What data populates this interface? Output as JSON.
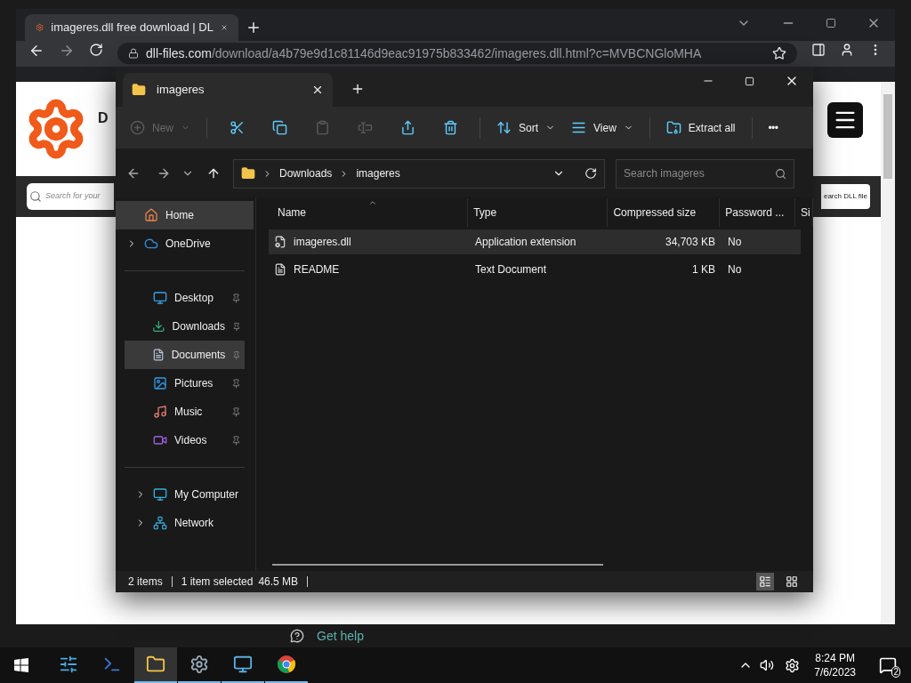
{
  "browser": {
    "tab_title": "imageres.dll free download | DL",
    "url_domain": "dll-files.com",
    "url_path": "/download/a4b79e9d1c81146d9eac91975b833462/imageres.dll.html?c=MVBCNGloMHA",
    "page": {
      "site_title": "D",
      "search_placeholder": "Search for your",
      "search_button": "earch DLL file"
    }
  },
  "explorer": {
    "tab_title": "imageres",
    "toolbar": [
      {
        "kind": "menu",
        "label": "New",
        "disabled": true
      },
      {
        "kind": "separator"
      },
      {
        "kind": "icon",
        "disabled": false
      },
      {
        "kind": "icon",
        "disabled": false
      },
      {
        "kind": "icon",
        "disabled": true
      },
      {
        "kind": "icon",
        "disabled": true
      },
      {
        "kind": "icon",
        "disabled": false
      },
      {
        "kind": "icon",
        "disabled": false
      },
      {
        "kind": "separator"
      },
      {
        "kind": "menu",
        "label": "Sort",
        "disabled": false
      },
      {
        "kind": "menu",
        "label": "View",
        "disabled": false
      },
      {
        "kind": "separator"
      },
      {
        "kind": "button",
        "label": "Extract all",
        "disabled": false
      },
      {
        "kind": "separator"
      },
      {
        "kind": "text",
        "label": "•••",
        "disabled": false
      }
    ],
    "breadcrumb": [
      "Downloads",
      "imageres"
    ],
    "search_placeholder": "Search imageres",
    "sidebar": [
      [
        {
          "label": "Home",
          "expandable": false,
          "pinned": false,
          "highlighted": true
        },
        {
          "label": "OneDrive",
          "expandable": true,
          "pinned": false,
          "highlighted": false
        }
      ],
      [
        {
          "label": "Desktop",
          "expandable": false,
          "pinned": true,
          "highlighted": false
        },
        {
          "label": "Downloads",
          "expandable": false,
          "pinned": true,
          "highlighted": false
        },
        {
          "label": "Documents",
          "expandable": false,
          "pinned": true,
          "highlighted": true
        },
        {
          "label": "Pictures",
          "expandable": false,
          "pinned": true,
          "highlighted": false
        },
        {
          "label": "Music",
          "expandable": false,
          "pinned": true,
          "highlighted": false
        },
        {
          "label": "Videos",
          "expandable": false,
          "pinned": true,
          "highlighted": false
        }
      ],
      [
        {
          "label": "My Computer",
          "expandable": true,
          "pinned": false,
          "highlighted": false
        },
        {
          "label": "Network",
          "expandable": true,
          "pinned": false,
          "highlighted": false
        }
      ]
    ],
    "columns": [
      "Name",
      "Type",
      "Compressed size",
      "Password ...",
      "Si"
    ],
    "rows": [
      {
        "name": "imageres.dll",
        "type": "Application extension",
        "size": "34,703 KB",
        "password": "No",
        "selected": true
      },
      {
        "name": "README",
        "type": "Text Document",
        "size": "1 KB",
        "password": "No",
        "selected": false
      }
    ],
    "status": [
      "2 items",
      "1 item selected",
      "46.5 MB"
    ],
    "views": [
      {
        "selected": true
      },
      {
        "selected": false
      }
    ]
  },
  "get_help": "Get help",
  "taskbar": {
    "apps": [
      {
        "running": false,
        "active": false
      },
      {
        "running": false,
        "active": false
      },
      {
        "running": true,
        "active": true
      },
      {
        "running": true,
        "active": false
      },
      {
        "running": true,
        "active": false
      },
      {
        "running": true,
        "active": false
      }
    ],
    "time": "8:24 PM",
    "date": "7/6/2023",
    "notifications": "2"
  }
}
